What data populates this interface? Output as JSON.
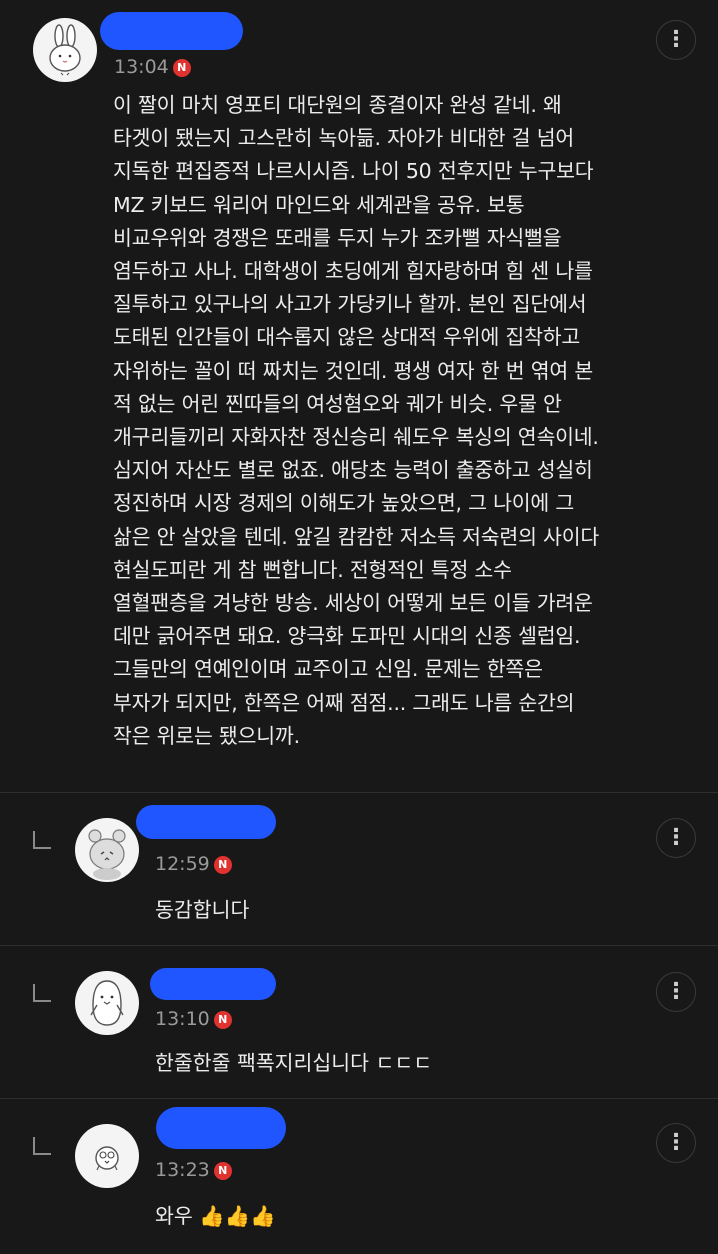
{
  "main_comment": {
    "time": "13:04",
    "new_badge": "N",
    "more_label": "⋮",
    "text": "이 짤이 마치 영포티 대단원의 종결이자 완성 같네. 왜\n타겟이 됐는지 고스란히 녹아듦. 자아가 비대한 걸 넘어\n지독한 편집증적 나르시시즘. 나이 50 전후지만 누구보다\nMZ 키보드 워리어 마인드와 세계관을 공유. 보통\n비교우위와 경쟁은 또래를 두지 누가 조카뻘 자식뻘을\n염두하고 사나. 대학생이 초딩에게 힘자랑하며 힘 센 나를\n질투하고 있구나의 사고가 가당키나 할까. 본인 집단에서\n도태된 인간들이 대수롭지 않은 상대적 우위에 집착하고\n자위하는 꼴이 떠 짜치는 것인데. 평생 여자 한 번 엮여 본\n적 없는 어린 찐따들의 여성혐오와 궤가 비슷. 우물 안\n개구리들끼리 자화자찬 정신승리 쉐도우 복싱의 연속이네.\n심지어 자산도 별로 없죠. 애당초 능력이 출중하고 성실히\n정진하며 시장 경제의 이해도가 높았으면, 그 나이에 그\n삶은 안 살았을 텐데. 앞길 캄캄한 저소득 저숙련의 사이다\n현실도피란 게 참 뻔합니다. 전형적인 특정 소수\n열혈팬층을 겨냥한 방송. 세상이 어떻게 보든 이들 가려운\n데만 긁어주면 돼요. 양극화 도파민 시대의 신종 셀럽임.\n그들만의 연예인이며 교주이고 신임. 문제는 한쪽은\n부자가 되지만, 한쪽은 어째 점점... 그래도 나름 순간의\n작은 위로는 됐으니까."
  },
  "replies": [
    {
      "time": "12:59",
      "new_badge": "N",
      "more_label": "⋮",
      "text": "동감합니다"
    },
    {
      "time": "13:10",
      "new_badge": "N",
      "more_label": "⋮",
      "text": "한줄한줄 팩폭지리십니다 ㄷㄷㄷ"
    },
    {
      "time": "13:23",
      "new_badge": "N",
      "more_label": "⋮",
      "text": "와우 👍👍👍"
    }
  ],
  "colors": {
    "background": "#181818",
    "redaction": "#1f56ff",
    "new_badge": "#e0322e"
  },
  "icons": {
    "main_avatar": "rabbit-avatar",
    "reply1_avatar": "bear-avatar",
    "reply2_avatar": "penguin-avatar",
    "reply3_avatar": "chick-avatar",
    "more": "kebab-menu-icon",
    "reply": "reply-corner-icon"
  }
}
